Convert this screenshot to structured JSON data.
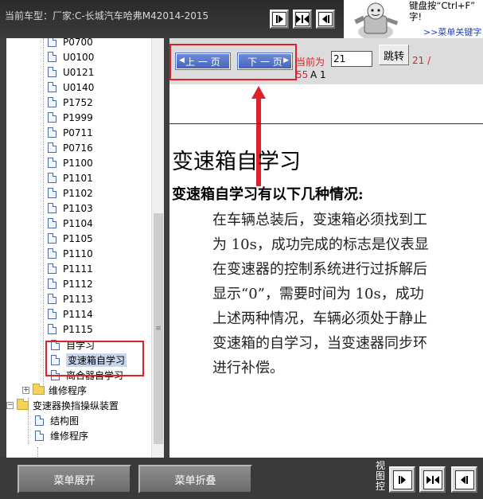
{
  "header": {
    "model_label": "当前车型：厂家:C-长城汽车哈弗M42014-2015",
    "tip_line1": "键盘按“Ctrl+F”",
    "tip_line2": "字!",
    "tip_link": ">>菜单关键字",
    "nav_icons": [
      "next-page-icon",
      "expand-both-icon",
      "prev-page-icon"
    ]
  },
  "tree": {
    "codes": [
      "P0700",
      "U0100",
      "U0121",
      "U0140",
      "P1752",
      "P1999",
      "P0711",
      "P0716",
      "P1100",
      "P1101",
      "P1102",
      "P1103",
      "P1104",
      "P1105",
      "P1110",
      "P1111",
      "P1112",
      "P1113",
      "P1114",
      "P1115"
    ],
    "item_self_learn": "自学习",
    "item_gearbox_learn": "变速箱自学习",
    "item_clutch_learn": "离合器自学习",
    "folder_repair": "维修程序",
    "folder_shifter": "变速器换挡操纵装置",
    "child_structure": "结构图",
    "child_repair": "维修程序"
  },
  "pager": {
    "prev_label": "上 一 页",
    "next_label": "下 一 页",
    "current_label": "当前为",
    "current_page": "21",
    "jump_label": "跳转",
    "page_of": "21 /",
    "total": "55",
    "section": "A 1"
  },
  "document": {
    "title": "变速箱自学习",
    "subtitle": "变速箱自学习有以下几种情况:",
    "lines": [
      "在车辆总装后，变速箱必须找到工",
      "为 10s，成功完成的标志是仪表显",
      "在变速器的控制系统进行过拆解后",
      "显示“0”，需要时间为 10s，成功",
      "上述两种情况，车辆必须处于静止",
      "变速箱的自学习，当变速器同步环",
      "进行补偿。"
    ]
  },
  "footer": {
    "expand_label": "菜单展开",
    "collapse_label": "菜单折叠",
    "view_label": "视图控",
    "nav_icons": [
      "next-page-icon",
      "expand-both-icon",
      "prev-page-icon"
    ]
  },
  "colors": {
    "highlight": "#e0202a",
    "pager_button": "#4565bd",
    "pager_text": "#e02020"
  }
}
